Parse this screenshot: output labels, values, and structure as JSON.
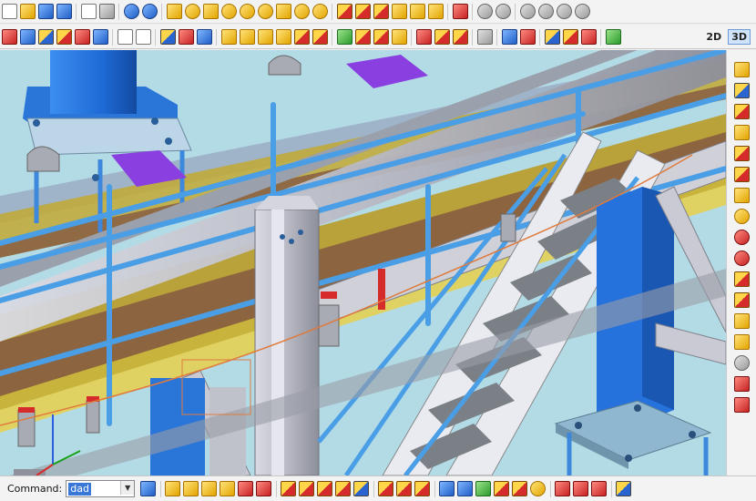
{
  "toolbar_top": {
    "icons": [
      "new-document-icon",
      "open-folder-icon",
      "save-icon",
      "save-all-icon",
      "copy-icon",
      "paste-icon",
      "undo-icon",
      "redo-icon",
      "box-solid-icon",
      "cylinder-icon",
      "wedge-icon",
      "cone-icon",
      "dome-icon",
      "torus-icon",
      "elbow-icon",
      "half-pipe-icon",
      "half-cylinder-icon",
      "union-icon",
      "subtract-icon",
      "intersect-icon",
      "extrude-icon",
      "revolve-icon",
      "sweep-icon",
      "material-icon",
      "zoom-extents-icon",
      "zoom-window-icon",
      "zoom-in-icon",
      "zoom-out-icon",
      "zoom-previous-icon",
      "zoom-realtime-icon"
    ]
  },
  "toolbar_second": {
    "icons": [
      "trim-icon",
      "extend-icon",
      "move-icon",
      "copy-object-icon",
      "mirror-icon",
      "array-icon",
      "box-wire-icon",
      "box-wire-2-icon",
      "align-icon",
      "scale-percent-icon",
      "rotate-icon",
      "stretch-icon",
      "fillet-icon",
      "chamfer-icon",
      "cut-icon",
      "split-icon",
      "slice-icon",
      "section-icon",
      "group-icon",
      "ungroup-icon",
      "properties-icon",
      "layer-icon",
      "attach-icon",
      "detach-icon",
      "hide-icon",
      "show-icon",
      "select-icon",
      "filter-icon",
      "snap-icon",
      "grid-icon",
      "render-icon"
    ],
    "view_2d": "2D",
    "view_3d": "3D"
  },
  "right_toolbar": {
    "icons": [
      "beam-icon",
      "column-icon",
      "plate-icon",
      "bolt-icon",
      "weld-icon",
      "cut-beam-icon",
      "connect-icon",
      "split-beam-icon",
      "check-icon",
      "clash-icon",
      "number-icon",
      "mark-icon",
      "drawing-icon",
      "export-icon",
      "refresh-icon",
      "delete-icon",
      "report-icon"
    ]
  },
  "status_bar": {
    "command_label": "Command:",
    "command_value": "dad",
    "icons": [
      "upload-icon",
      "profile-beam-icon",
      "profile-c-icon",
      "profile-l-icon",
      "profile-u-icon",
      "profile-i-icon",
      "profile-plate-icon",
      "snap-point-icon",
      "snap-line-icon",
      "snap-grid-icon",
      "snap-edge-icon",
      "snap-intersection-icon",
      "ortho-icon",
      "help-icon",
      "cursor-mode-icon",
      "connect-mode-icon",
      "node-icon",
      "link-icon",
      "measure-icon",
      "dimension-icon",
      "paint-icon",
      "lock-icon",
      "unlock-icon",
      "layer-stack-icon",
      "tree-icon"
    ]
  }
}
